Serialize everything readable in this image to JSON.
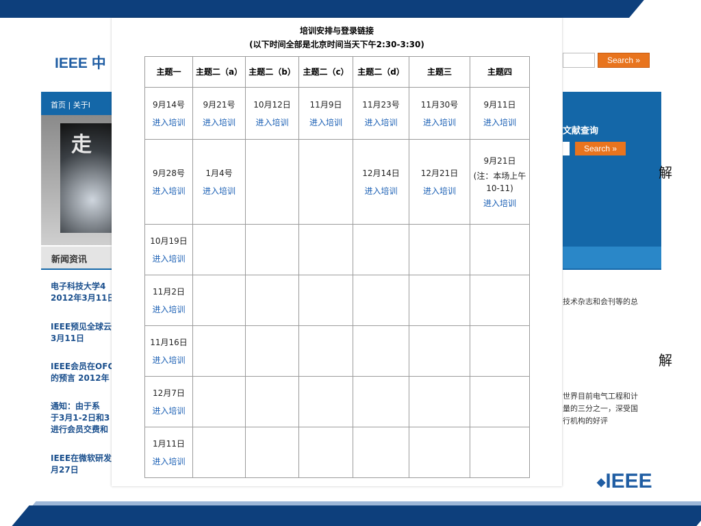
{
  "background_site": {
    "title": "IEEE 中",
    "nav": "首页 | 关于I",
    "hero_char": "走",
    "news_heading": "新闻资讯",
    "news_items": [
      [
        "电子科技大学4",
        "2012年3月11日"
      ],
      [
        "IEEE预见全球云",
        "3月11日"
      ],
      [
        "IEEE会员在OFC",
        "的预言 2012年"
      ],
      [
        "通知：由于系",
        "于3月1-2日和3",
        "进行会员交费和"
      ],
      [
        "IEEE在微软研发",
        "月27日"
      ]
    ],
    "search_button": "Search »",
    "lit_search_label": "文献查询",
    "lit_search_button": "Search »",
    "right_text_1": "技术杂志和会刊等的总",
    "right_text_2": [
      "世界目前电气工程和计",
      "量的三分之一，深受国",
      "行机构的好评"
    ],
    "slide_word_1": "解",
    "slide_word_2": "解",
    "logo": "IEEE"
  },
  "popup": {
    "title": "培训安排与登录链接",
    "subtitle": "(以下时间全部是北京时间当天下午2:30-3:30)",
    "columns": [
      "主题一",
      "主题二（a）",
      "主题二（b）",
      "主题二（c）",
      "主题二（d）",
      "主题三",
      "主题四"
    ],
    "link_text": "进入培训",
    "rows": [
      [
        "9月14号",
        "9月21号",
        "10月12日",
        "11月9日",
        "11月23号",
        "11月30号",
        "9月11日"
      ],
      [
        "9月28号",
        "1月4号",
        "",
        "",
        "12月14日",
        "12月21日",
        "9月21日"
      ],
      [
        "10月19日",
        "",
        "",
        "",
        "",
        "",
        ""
      ],
      [
        "11月2日",
        "",
        "",
        "",
        "",
        "",
        ""
      ],
      [
        "11月16日",
        "",
        "",
        "",
        "",
        "",
        ""
      ],
      [
        "12月7日",
        "",
        "",
        "",
        "",
        "",
        ""
      ],
      [
        "1月11日",
        "",
        "",
        "",
        "",
        "",
        ""
      ]
    ],
    "note": [
      "(注：本场上午",
      "10-11)"
    ]
  }
}
